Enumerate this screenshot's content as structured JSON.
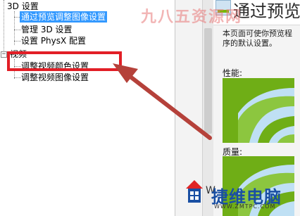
{
  "tree": {
    "category_3d": "3D 设置",
    "items_3d": [
      {
        "label": "通过预览调整图像设置",
        "selected": true
      },
      {
        "label": "管理 3D 设置",
        "selected": false
      },
      {
        "label": "设置 PhysX 配置",
        "selected": false
      }
    ],
    "category_video": "视频",
    "items_video": [
      {
        "label": "调整视频颜色设置"
      },
      {
        "label": "调整视频图像设置"
      }
    ]
  },
  "content": {
    "heading": "通过预览",
    "description": "本页面可使你预览程序的默认设置。",
    "performance_label": "性能:",
    "quality_label": "质量:"
  },
  "watermarks": {
    "top": "九八五资源网",
    "brand": "捷维电脑",
    "brand_prefix": "W",
    "url": "WWW.ZMTPC.COM"
  },
  "colors": {
    "selection": "#3399ff",
    "highlight_box": "#e21e26",
    "arrow": "#b5413a",
    "nvidia_green": "#76b900"
  }
}
